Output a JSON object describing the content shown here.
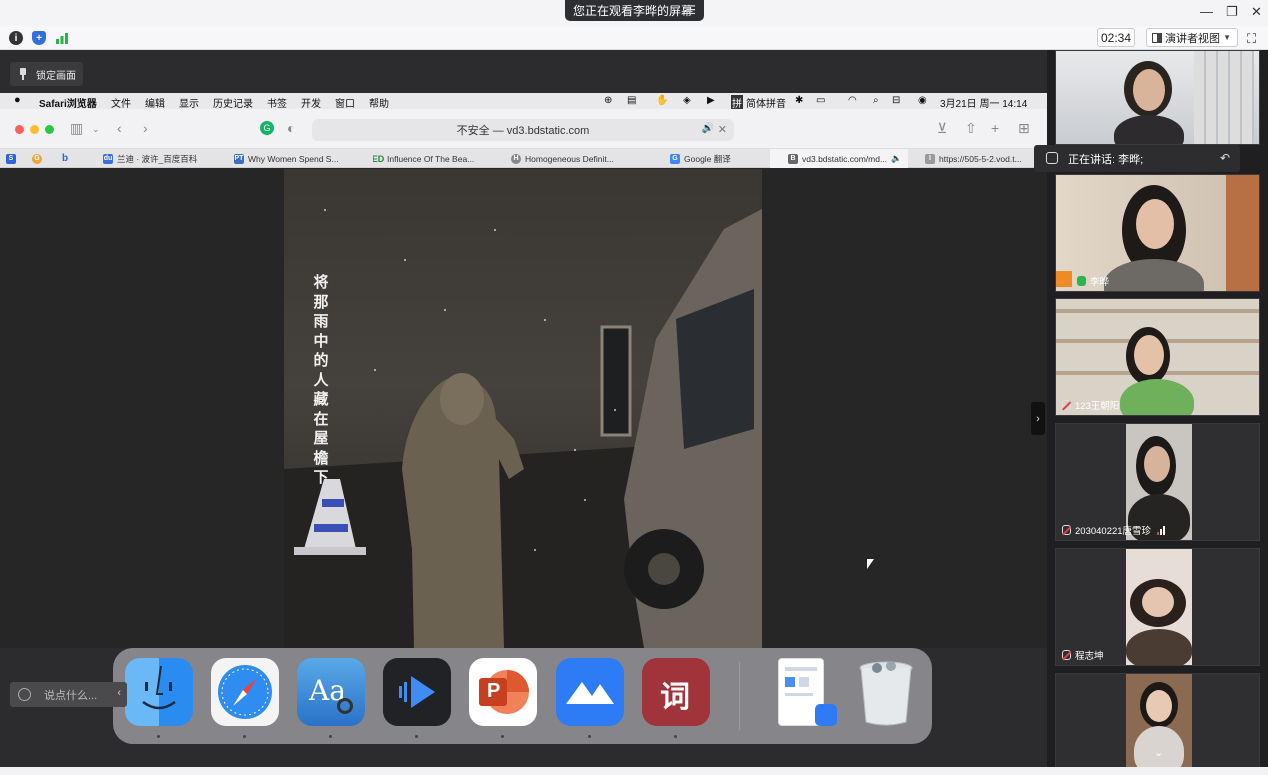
{
  "banner": {
    "share_text": "您正在观看李晔的屏幕",
    "menu_icon": "list-icon"
  },
  "window_controls": [
    "minimize-icon",
    "restore-icon",
    "close-icon"
  ],
  "meeting_toolbar": {
    "timer": "02:34",
    "presenter_view_label": "演讲者视图",
    "icons": [
      "info-icon",
      "shield-icon",
      "signal-icon",
      "fullscreen-icon"
    ]
  },
  "lock_button": {
    "label": "锁定画面"
  },
  "mac_menubar": {
    "app": "Safari浏览器",
    "menus": [
      "文件",
      "编辑",
      "显示",
      "历史记录",
      "书签",
      "开发",
      "窗口",
      "帮助"
    ],
    "input_method": "简体拼音",
    "datetime": "3月21日 周一 14:14"
  },
  "safari": {
    "address": "不安全 — vd3.bdstatic.com",
    "tabs": [
      {
        "label": "",
        "favicon": "S"
      },
      {
        "label": "",
        "favicon": "G"
      },
      {
        "label": "",
        "favicon": "b"
      },
      {
        "label": "兰迪 · 波许_百度百科",
        "favicon": "du"
      },
      {
        "label": "Why Women Spend S...",
        "favicon": "PT"
      },
      {
        "label": "Influence Of The Bea...",
        "favicon": "ED"
      },
      {
        "label": "Homogeneous Definit...",
        "favicon": "H"
      },
      {
        "label": "Google 翻译",
        "favicon": "G"
      },
      {
        "label": "vd3.bdstatic.com/md...",
        "favicon": "B"
      },
      {
        "label": "https://505-5-2.vod.t...",
        "favicon": "I"
      }
    ],
    "video_caption": "将那雨中的人藏在屋檐下"
  },
  "dock": {
    "apps": [
      "finder-icon",
      "safari-icon",
      "dictionary-icon",
      "video-player-icon",
      "powerpoint-icon",
      "lark-icon",
      "ci-dictionary-icon",
      "document-preview-icon",
      "trash-icon"
    ],
    "ci_glyph": "词",
    "aa_glyph": "Aa",
    "ppt_glyph": "P"
  },
  "chat": {
    "placeholder": "说点什么..."
  },
  "speaking": {
    "label": "正在讲话: 李晔;"
  },
  "participants": [
    {
      "name": "",
      "muted": false
    },
    {
      "name": "李晔",
      "muted": false,
      "mic_on": true
    },
    {
      "name": "123王朝阳",
      "muted": true
    },
    {
      "name": "203040221唐雪珍",
      "muted": true
    },
    {
      "name": "程志坤",
      "muted": true
    },
    {
      "name": "",
      "muted": false
    }
  ]
}
